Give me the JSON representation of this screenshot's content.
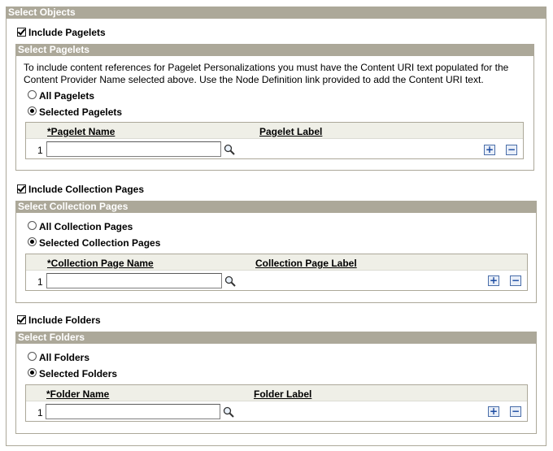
{
  "page": {
    "title": "Select Objects"
  },
  "pagelets": {
    "include_label": "Include Pagelets",
    "include_checked": true,
    "section_title": "Select Pagelets",
    "info_line1": "To include content references for Pagelet Personalizations you must have the Content URI text populated for the",
    "info_line2": "Content Provider Name selected above. Use the Node Definition link provided to add the Content URI text.",
    "option_all": "All Pagelets",
    "option_selected": "Selected Pagelets",
    "selected_option": "selected",
    "col_name": "*Pagelet Name",
    "col_label": "Pagelet Label",
    "row_number": "1",
    "name_value": ""
  },
  "collections": {
    "include_label": "Include Collection Pages",
    "include_checked": true,
    "section_title": "Select Collection Pages",
    "option_all": "All Collection Pages",
    "option_selected": "Selected Collection Pages",
    "selected_option": "selected",
    "col_name": "*Collection Page Name",
    "col_label": "Collection Page Label",
    "row_number": "1",
    "name_value": ""
  },
  "folders": {
    "include_label": "Include Folders",
    "include_checked": true,
    "section_title": "Select Folders",
    "option_all": "All Folders",
    "option_selected": "Selected Folders",
    "selected_option": "selected",
    "col_name": "*Folder Name",
    "col_label": "Folder Label",
    "row_number": "1",
    "name_value": ""
  },
  "icons": {
    "lookup": "magnifier-lookup-icon",
    "add_row": "+",
    "delete_row": "−"
  },
  "colors": {
    "header_bg": "#aca899",
    "header_text": "#ffffff",
    "grid_header_bg": "#efefe7",
    "row_button_accent": "#1a4aa0"
  }
}
